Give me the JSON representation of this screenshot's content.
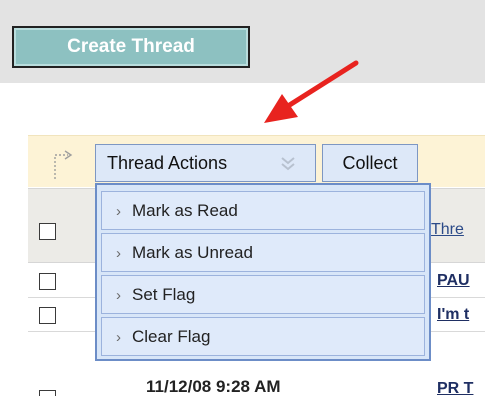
{
  "toolbar": {
    "create_thread_label": "Create Thread"
  },
  "action_bar": {
    "thread_actions_label": "Thread Actions",
    "collect_label": "Collect"
  },
  "table": {
    "thread_column_label": "Thre",
    "rows": [
      {
        "title": "PAU",
        "date": ""
      },
      {
        "title": "I'm t",
        "date": ""
      },
      {
        "title": "PR T",
        "date": "11/12/08 9:28 AM"
      }
    ]
  },
  "thread_actions_menu": {
    "items": [
      "Mark as Read",
      "Mark as Unread",
      "Set Flag",
      "Clear Flag"
    ]
  },
  "colors": {
    "create_button_bg": "#8dc1c1",
    "menu_bg": "#d8e6f8",
    "menu_border": "#6c8dc7",
    "annotation_arrow": "#e8231f"
  },
  "icons": {
    "menu_item_bullet": "chevron-right-icon",
    "dropdown_indicator": "double-chevron-down-icon",
    "action_bar_connector": "dotted-arrow-icon",
    "annotation": "red-arrow-icon"
  }
}
